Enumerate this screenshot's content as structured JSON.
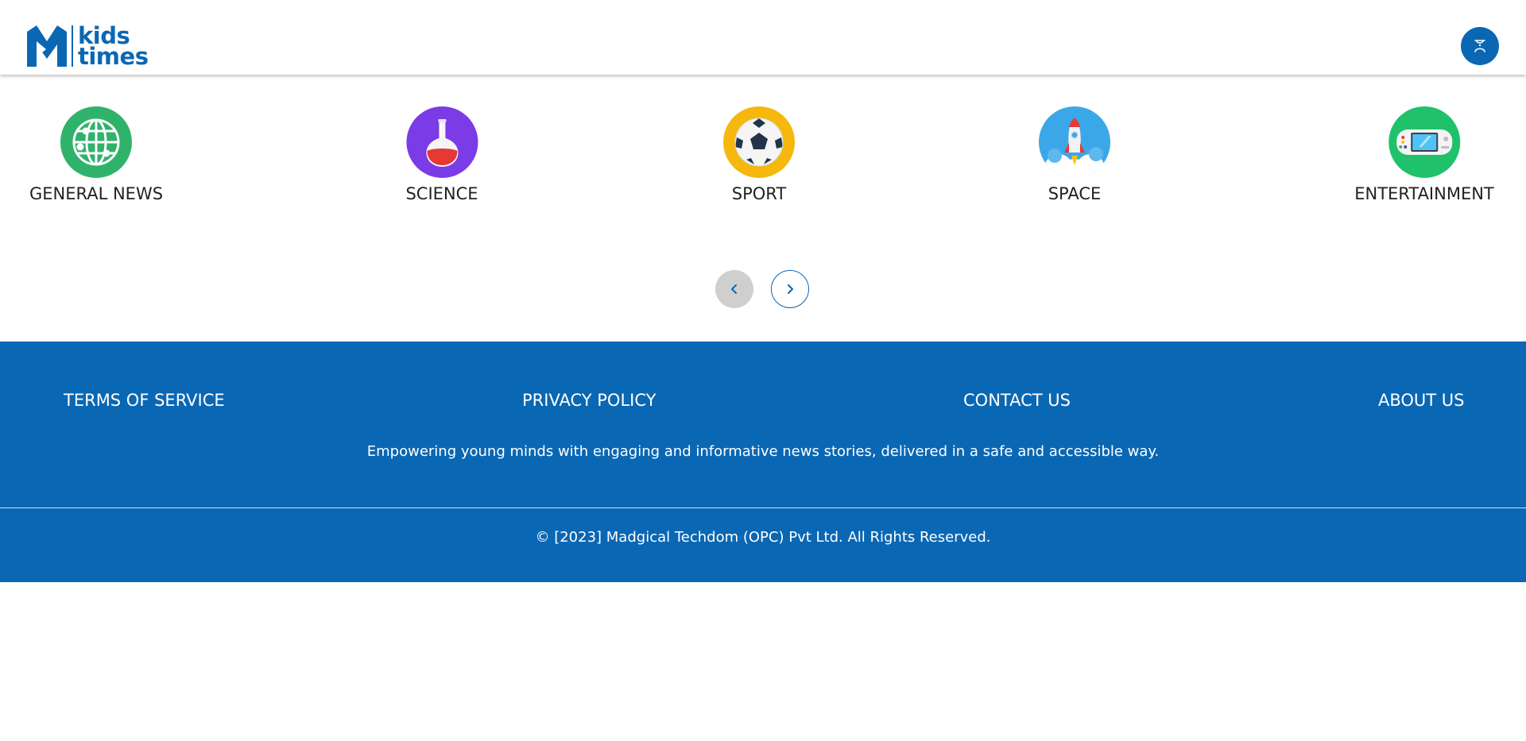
{
  "brand": {
    "logo_line1": "kids",
    "logo_line2": "times",
    "color": "#0a67b4"
  },
  "header": {
    "user_icon": "user-icon"
  },
  "categories": [
    {
      "label": "GENERAL NEWS",
      "icon": "globe-icon",
      "color": "#2fb36b"
    },
    {
      "label": "SCIENCE",
      "icon": "flask-icon",
      "color": "#7b3be6"
    },
    {
      "label": "SPORT",
      "icon": "soccer-ball-icon",
      "color": "#f6b80c"
    },
    {
      "label": "SPACE",
      "icon": "rocket-icon",
      "color": "#3aa8e8"
    },
    {
      "label": "ENTERTAINMENT",
      "icon": "game-console-icon",
      "color": "#1fc16b"
    }
  ],
  "carousel": {
    "prev_icon": "chevron-left-icon",
    "next_icon": "chevron-right-icon"
  },
  "footer": {
    "links": [
      "TERMS OF SERVICE",
      "PRIVACY POLICY",
      "CONTACT US",
      "ABOUT US"
    ],
    "tagline": "Empowering young minds with engaging and informative news stories, delivered in a safe and accessible way.",
    "copyright": "© [2023] Madgical Techdom (OPC) Pvt Ltd. All Rights Reserved."
  }
}
